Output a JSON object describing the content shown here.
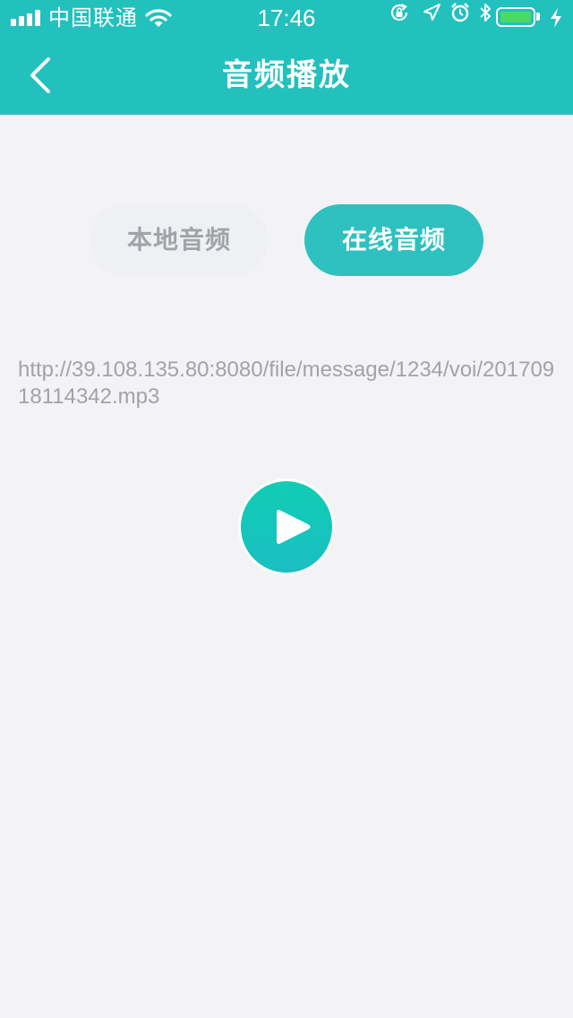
{
  "status_bar": {
    "carrier": "中国联通",
    "time": "17:46",
    "battery_level": 1.0,
    "battery_color": "#4cd964",
    "icons": [
      "signal-icon",
      "wifi-icon",
      "rotation-lock-icon",
      "location-icon",
      "alarm-icon",
      "bluetooth-icon",
      "battery-icon",
      "charging-icon"
    ]
  },
  "navbar": {
    "title": "音频播放",
    "back_icon": "chevron-left-icon",
    "color": "#22c1be"
  },
  "tabs": [
    {
      "label": "本地音频",
      "active": false
    },
    {
      "label": "在线音频",
      "active": true
    }
  ],
  "audio": {
    "url": "http://39.108.135.80:8080/file/message/1234/voi/20170918114342.mp3"
  },
  "player": {
    "icon": "play-icon"
  }
}
